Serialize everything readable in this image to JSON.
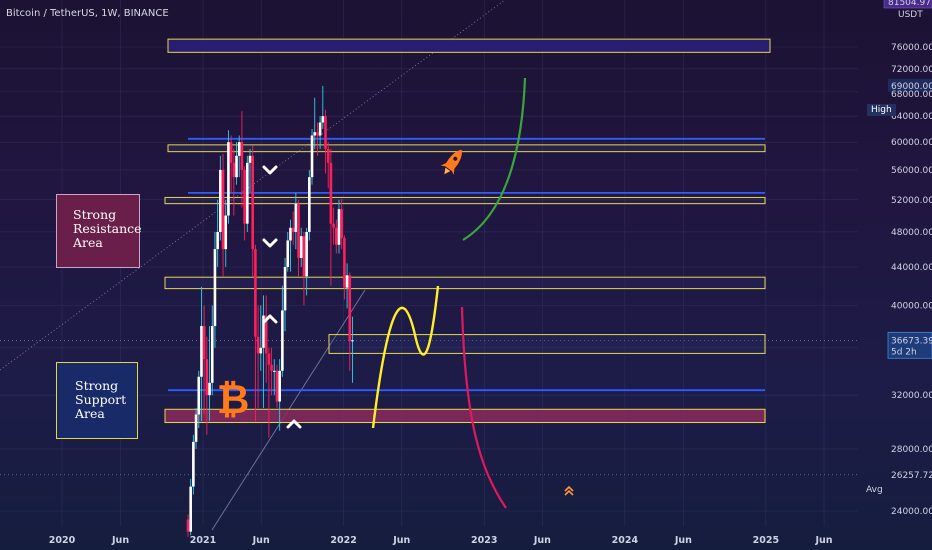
{
  "header": {
    "title": "Bitcoin / TetherUS, 1W, BINANCE",
    "currency": "USDT"
  },
  "price_axis": {
    "labels": [
      "76000.00",
      "72000.00",
      "69000.00",
      "68000.00",
      "64000.00",
      "60000.00",
      "56000.00",
      "52000.00",
      "48000.00",
      "44000.00",
      "40000.00",
      "36673.39",
      "32000.00",
      "28000.00",
      "26257.72",
      "24000.00"
    ],
    "high_label": "High",
    "high_value": "69000.00",
    "last_value": "36673.39",
    "countdown": "5d 2h",
    "avg_label": "Avg",
    "avg_value": "26257.72",
    "top_value": "81504.97"
  },
  "time_axis": {
    "labels": [
      "2020",
      "Jun",
      "2021",
      "Jun",
      "2022",
      "Jun",
      "2023",
      "Jun",
      "2024",
      "Jun",
      "2025",
      "Jun"
    ]
  },
  "annotations": {
    "resistance": [
      "Strong",
      "Resistance",
      "Area"
    ],
    "support": [
      "Strong",
      "Support",
      "Area"
    ]
  },
  "colors": {
    "background": "#1d1a40",
    "up_candle": "#ffffff",
    "down_candle": "#ff1f5a",
    "zone_outline": "#e6d84a",
    "resistance_line": "#2f5bff",
    "green_arc": "#3aa63a",
    "yellow_curve": "#ffee2a",
    "pink_curve": "#e0185e",
    "rocket": "#ff7a1a"
  },
  "chart_data": {
    "type": "candlestick",
    "title": "Bitcoin / TetherUS, 1W, BINANCE",
    "x_range": [
      "2019-11",
      "2025-07"
    ],
    "ylim": [
      22000,
      81504.97
    ],
    "y_scale": "log",
    "series": [
      {
        "values": [
          {
            "x": "2020-11-23",
            "o": 23500,
            "h": 23800,
            "l": 22500,
            "c": 22800
          },
          {
            "x": "2020-11-30",
            "o": 22800,
            "h": 26000,
            "l": 22600,
            "c": 25500
          },
          {
            "x": "2020-12-07",
            "o": 25500,
            "h": 29000,
            "l": 25000,
            "c": 28500
          },
          {
            "x": "2020-12-14",
            "o": 28500,
            "h": 31000,
            "l": 28000,
            "c": 30500
          },
          {
            "x": "2020-12-21",
            "o": 30500,
            "h": 34000,
            "l": 29500,
            "c": 33500
          },
          {
            "x": "2020-12-28",
            "o": 33500,
            "h": 41900,
            "l": 30000,
            "c": 38000
          },
          {
            "x": "2021-01-04",
            "o": 38000,
            "h": 40000,
            "l": 30500,
            "c": 35000
          },
          {
            "x": "2021-01-11",
            "o": 35000,
            "h": 37000,
            "l": 29000,
            "c": 32000
          },
          {
            "x": "2021-01-18",
            "o": 32000,
            "h": 38000,
            "l": 30000,
            "c": 33000
          },
          {
            "x": "2021-01-25",
            "o": 33000,
            "h": 40000,
            "l": 32000,
            "c": 38000
          },
          {
            "x": "2021-02-01",
            "o": 38000,
            "h": 48000,
            "l": 36000,
            "c": 46000
          },
          {
            "x": "2021-02-08",
            "o": 46000,
            "h": 52000,
            "l": 44000,
            "c": 48000
          },
          {
            "x": "2021-02-15",
            "o": 48000,
            "h": 58000,
            "l": 47000,
            "c": 56000
          },
          {
            "x": "2021-02-22",
            "o": 56000,
            "h": 58300,
            "l": 43000,
            "c": 46000
          },
          {
            "x": "2021-03-01",
            "o": 46000,
            "h": 52000,
            "l": 44000,
            "c": 50000
          },
          {
            "x": "2021-03-08",
            "o": 50000,
            "h": 61800,
            "l": 49000,
            "c": 60000
          },
          {
            "x": "2021-03-15",
            "o": 60000,
            "h": 61000,
            "l": 53000,
            "c": 57000
          },
          {
            "x": "2021-03-22",
            "o": 57000,
            "h": 59000,
            "l": 50000,
            "c": 55000
          },
          {
            "x": "2021-03-29",
            "o": 55000,
            "h": 60000,
            "l": 54000,
            "c": 58000
          },
          {
            "x": "2021-04-05",
            "o": 58000,
            "h": 61000,
            "l": 55000,
            "c": 60000
          },
          {
            "x": "2021-04-12",
            "o": 60000,
            "h": 64800,
            "l": 51000,
            "c": 56000
          },
          {
            "x": "2021-04-19",
            "o": 56000,
            "h": 56500,
            "l": 47000,
            "c": 49000
          },
          {
            "x": "2021-04-26",
            "o": 49000,
            "h": 58000,
            "l": 48000,
            "c": 57000
          },
          {
            "x": "2021-05-03",
            "o": 57000,
            "h": 59000,
            "l": 53000,
            "c": 58000
          },
          {
            "x": "2021-05-10",
            "o": 58000,
            "h": 59500,
            "l": 43000,
            "c": 46000
          },
          {
            "x": "2021-05-17",
            "o": 46000,
            "h": 46500,
            "l": 30000,
            "c": 37000
          },
          {
            "x": "2021-05-24",
            "o": 37000,
            "h": 40000,
            "l": 31000,
            "c": 35500
          },
          {
            "x": "2021-05-31",
            "o": 35500,
            "h": 40000,
            "l": 34000,
            "c": 36000
          },
          {
            "x": "2021-06-07",
            "o": 36000,
            "h": 41000,
            "l": 31000,
            "c": 39000
          },
          {
            "x": "2021-06-14",
            "o": 39000,
            "h": 41000,
            "l": 33000,
            "c": 35500
          },
          {
            "x": "2021-06-21",
            "o": 35500,
            "h": 36000,
            "l": 28800,
            "c": 34500
          },
          {
            "x": "2021-06-28",
            "o": 34500,
            "h": 36000,
            "l": 32000,
            "c": 34000
          },
          {
            "x": "2021-07-05",
            "o": 34000,
            "h": 35000,
            "l": 32000,
            "c": 34000
          },
          {
            "x": "2021-07-12",
            "o": 34000,
            "h": 34500,
            "l": 31000,
            "c": 31500
          },
          {
            "x": "2021-07-19",
            "o": 31500,
            "h": 35000,
            "l": 29300,
            "c": 34000
          },
          {
            "x": "2021-07-26",
            "o": 34000,
            "h": 42000,
            "l": 33500,
            "c": 39500
          },
          {
            "x": "2021-08-02",
            "o": 39500,
            "h": 45000,
            "l": 37500,
            "c": 44000
          },
          {
            "x": "2021-08-09",
            "o": 44000,
            "h": 48000,
            "l": 43500,
            "c": 47000
          },
          {
            "x": "2021-08-16",
            "o": 47000,
            "h": 49500,
            "l": 43500,
            "c": 48500
          },
          {
            "x": "2021-08-23",
            "o": 48500,
            "h": 50500,
            "l": 46500,
            "c": 48000
          },
          {
            "x": "2021-08-30",
            "o": 48000,
            "h": 52900,
            "l": 46000,
            "c": 51500
          },
          {
            "x": "2021-09-06",
            "o": 51500,
            "h": 52000,
            "l": 43000,
            "c": 45000
          },
          {
            "x": "2021-09-13",
            "o": 45000,
            "h": 48500,
            "l": 44000,
            "c": 47500
          },
          {
            "x": "2021-09-20",
            "o": 47500,
            "h": 48000,
            "l": 40000,
            "c": 43000
          },
          {
            "x": "2021-09-27",
            "o": 43000,
            "h": 48500,
            "l": 41000,
            "c": 48000
          },
          {
            "x": "2021-10-04",
            "o": 48000,
            "h": 56000,
            "l": 47000,
            "c": 55000
          },
          {
            "x": "2021-10-11",
            "o": 55000,
            "h": 62000,
            "l": 54000,
            "c": 61000
          },
          {
            "x": "2021-10-18",
            "o": 61000,
            "h": 67000,
            "l": 59000,
            "c": 61500
          },
          {
            "x": "2021-10-25",
            "o": 61500,
            "h": 63000,
            "l": 58000,
            "c": 61000
          },
          {
            "x": "2021-11-01",
            "o": 61000,
            "h": 64000,
            "l": 59000,
            "c": 63000
          },
          {
            "x": "2021-11-08",
            "o": 63000,
            "h": 69000,
            "l": 62000,
            "c": 64000
          },
          {
            "x": "2021-11-15",
            "o": 64000,
            "h": 65000,
            "l": 55500,
            "c": 59000
          },
          {
            "x": "2021-11-22",
            "o": 59000,
            "h": 60000,
            "l": 53500,
            "c": 57000
          },
          {
            "x": "2021-11-29",
            "o": 57000,
            "h": 59000,
            "l": 42000,
            "c": 49000
          },
          {
            "x": "2021-12-06",
            "o": 49000,
            "h": 51000,
            "l": 46500,
            "c": 48500
          },
          {
            "x": "2021-12-13",
            "o": 48500,
            "h": 49500,
            "l": 45500,
            "c": 46500
          },
          {
            "x": "2021-12-20",
            "o": 46500,
            "h": 52000,
            "l": 45500,
            "c": 50800
          },
          {
            "x": "2021-12-27",
            "o": 50800,
            "h": 52100,
            "l": 46000,
            "c": 47300
          },
          {
            "x": "2022-01-03",
            "o": 47300,
            "h": 47600,
            "l": 40600,
            "c": 41800
          },
          {
            "x": "2022-01-10",
            "o": 41800,
            "h": 44400,
            "l": 39700,
            "c": 43100
          },
          {
            "x": "2022-01-17",
            "o": 43100,
            "h": 43400,
            "l": 34000,
            "c": 36600
          },
          {
            "x": "2022-01-24",
            "o": 36600,
            "h": 38900,
            "l": 33000,
            "c": 36673.39
          }
        ]
      }
    ],
    "zones": [
      {
        "from": 75000,
        "to": 77500,
        "x_from": "2020-11-01",
        "x_to": "2025-01-01"
      },
      {
        "from": 58600,
        "to": 59600,
        "x_from": "2020-11-01",
        "x_to": "2025-01-01"
      },
      {
        "from": 51500,
        "to": 52300,
        "x_from": "2020-11-01",
        "x_to": "2025-01-01"
      },
      {
        "from": 41700,
        "to": 42900,
        "x_from": "2020-11-01",
        "x_to": "2025-01-01"
      },
      {
        "from": 35500,
        "to": 37200,
        "x_from": "2022-01-01",
        "x_to": "2025-01-01"
      },
      {
        "from": 29900,
        "to": 30900,
        "x_from": "2020-11-01",
        "x_to": "2025-01-01"
      }
    ],
    "levels": [
      60500,
      52900,
      32400
    ],
    "high": 69000,
    "last": 36673.39,
    "avg": 26257.72
  }
}
